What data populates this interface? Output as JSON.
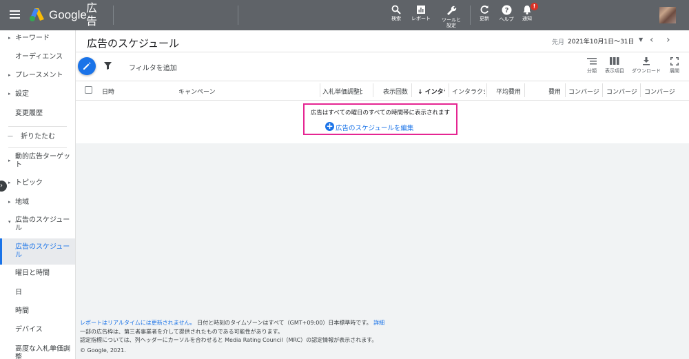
{
  "header": {
    "brand": "Google",
    "product": "広告",
    "actions": [
      {
        "icon": "search-icon",
        "label": "検索"
      },
      {
        "icon": "reports-icon",
        "label": "レポート"
      },
      {
        "icon": "wrench-icon",
        "label": "ツールと設定"
      },
      {
        "icon": "refresh-icon",
        "label": "更新"
      },
      {
        "icon": "help-icon",
        "label": "ヘルプ"
      },
      {
        "icon": "bell-icon",
        "label": "通知",
        "badge": "!"
      }
    ]
  },
  "sidebar": {
    "items": [
      {
        "label": "キーワード",
        "arrow": "▸"
      },
      {
        "label": "オーディエンス",
        "arrow": ""
      },
      {
        "label": "プレースメント",
        "arrow": "▸"
      },
      {
        "label": "設定",
        "arrow": "▸"
      },
      {
        "label": "変更履歴",
        "arrow": ""
      },
      {
        "label": "折りたたむ",
        "arrow": "—"
      },
      {
        "label": "動的広告ターゲット",
        "arrow": "▸"
      },
      {
        "label": "トピック",
        "arrow": "▸"
      },
      {
        "label": "地域",
        "arrow": "▸"
      },
      {
        "label": "広告のスケジュール",
        "arrow": "▾"
      },
      {
        "label": "広告のスケジュール",
        "arrow": "",
        "active": true
      },
      {
        "label": "曜日と時間",
        "arrow": ""
      },
      {
        "label": "日",
        "arrow": ""
      },
      {
        "label": "時間",
        "arrow": ""
      },
      {
        "label": "デバイス",
        "arrow": ""
      },
      {
        "label": "高度な入札単価調整",
        "arrow": ""
      }
    ]
  },
  "main": {
    "title": "広告のスケジュール",
    "date_prefix": "先月",
    "date_range": "2021年10月1日〜31日",
    "filter_label": "フィルタを追加",
    "tools": [
      {
        "icon": "segment-icon",
        "label": "分類"
      },
      {
        "icon": "columns-icon",
        "label": "表示項目"
      },
      {
        "icon": "download-icon",
        "label": "ダウンロード"
      },
      {
        "icon": "expand-icon",
        "label": "展開"
      }
    ],
    "columns": [
      "日時",
      "キャンペーン",
      "入札単価調整比",
      "表示回数",
      "↓ インタラクション",
      "インタラクション率",
      "平均費用",
      "費用",
      "コンバージョン",
      "コンバージョン",
      "コンバージョン"
    ],
    "notice_text": "広告はすべての曜日のすべての時間帯に表示されます",
    "edit_link": "広告のスケジュールを編集"
  },
  "footer": {
    "line1_link": "レポートはリアルタイムには更新されません。",
    "line1_text": "日付と時刻のタイムゾーンはすべて（GMT+09:00）日本標準時です。",
    "line1_detail": "詳細",
    "line2": "一部の広告枠は、第三者事業者を介して提供されたものである可能性があります。",
    "line3": "認定指標については、列ヘッダーにカーソルを合わせると Media Rating Council（MRC）の認定情報が表示されます。",
    "copyright": "© Google, 2021."
  }
}
